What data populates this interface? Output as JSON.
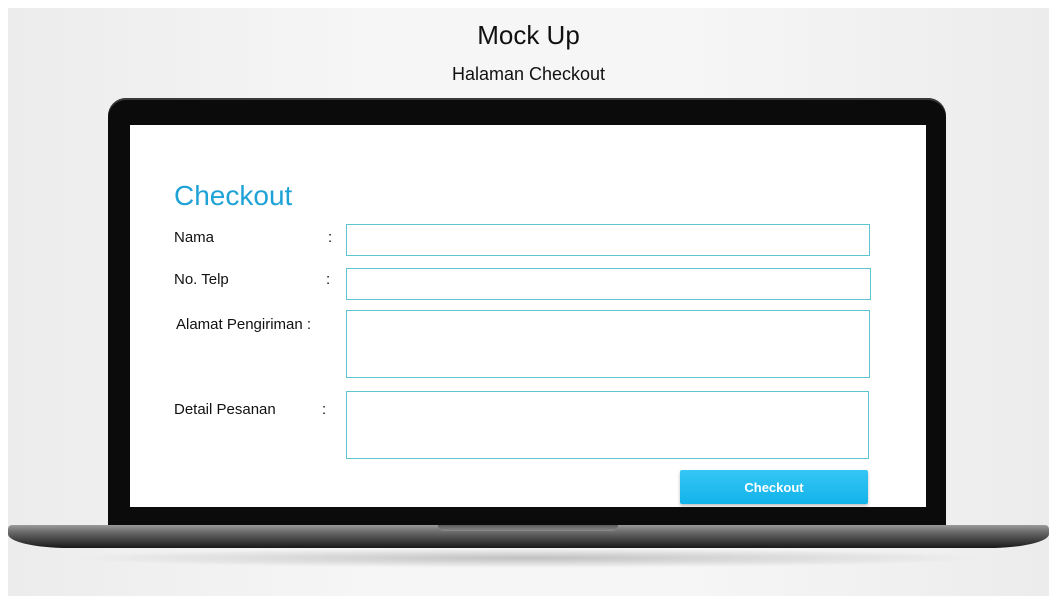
{
  "header": {
    "title": "Mock Up",
    "subtitle": "Halaman Checkout"
  },
  "form": {
    "title": "Checkout",
    "fields": [
      {
        "label": "Nama",
        "colon": ":",
        "value": ""
      },
      {
        "label": "No. Telp",
        "colon": ":",
        "value": ""
      },
      {
        "label": "Alamat Pengiriman :",
        "value": ""
      },
      {
        "label": "Detail Pesanan",
        "colon": ":",
        "value": ""
      }
    ],
    "submit_label": "Checkout"
  },
  "colors": {
    "accent": "#1fa3d6",
    "field_border": "#5fc4cf",
    "button": "#12b3ea"
  }
}
